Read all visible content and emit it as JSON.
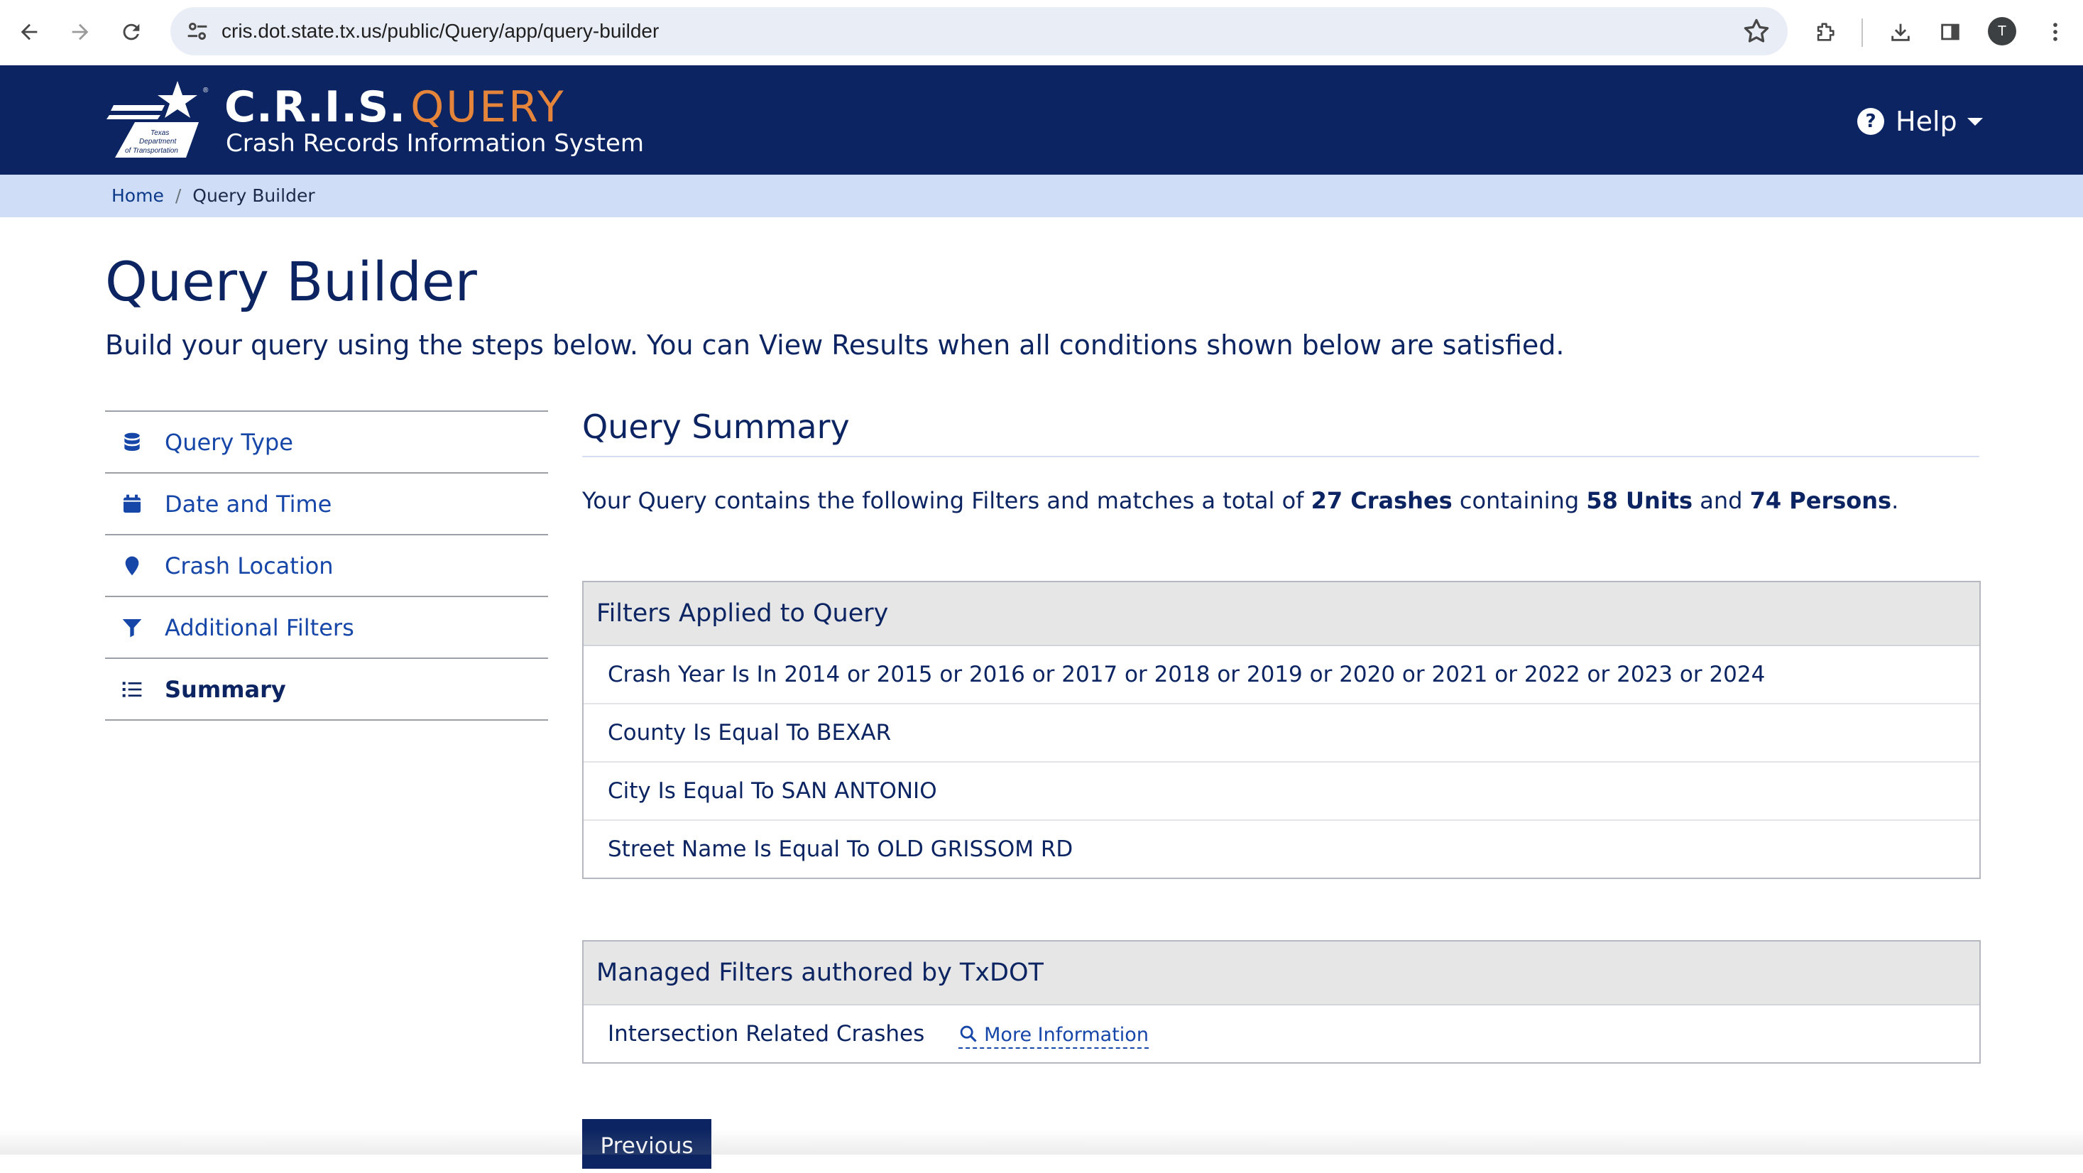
{
  "browser": {
    "url": "cris.dot.state.tx.us/public/Query/app/query-builder",
    "profile_initial": "T"
  },
  "header": {
    "logo_text": "Texas Department of Transportation",
    "brand_main": "C.R.I.S.",
    "brand_query": "QUERY",
    "brand_sub": "Crash Records Information System",
    "help_label": "Help"
  },
  "breadcrumb": {
    "home": "Home",
    "separator": "/",
    "current": "Query Builder"
  },
  "page": {
    "title": "Query Builder",
    "lead": "Build your query using the steps below. You can View Results when all conditions shown below are satisfied."
  },
  "sidenav": {
    "items": [
      {
        "label": "Query Type",
        "icon": "database-icon"
      },
      {
        "label": "Date and Time",
        "icon": "calendar-icon"
      },
      {
        "label": "Crash Location",
        "icon": "map-pin-icon"
      },
      {
        "label": "Additional Filters",
        "icon": "filter-icon"
      },
      {
        "label": "Summary",
        "icon": "list-icon",
        "active": true
      }
    ]
  },
  "summary": {
    "title": "Query Summary",
    "text_prefix": "Your Query contains the following Filters and matches a total of",
    "crashes": "27 Crashes",
    "text_mid1": "containing",
    "units": "58 Units",
    "text_mid2": "and",
    "persons": "74 Persons",
    "text_end": "."
  },
  "filters_panel": {
    "title": "Filters Applied to Query",
    "rows": [
      "Crash Year Is In 2014 or 2015 or 2016 or 2017 or 2018 or 2019 or 2020 or 2021 or 2022 or 2023 or 2024",
      "County Is Equal To BEXAR",
      "City Is Equal To SAN ANTONIO",
      "Street Name Is Equal To OLD GRISSOM RD"
    ]
  },
  "managed_panel": {
    "title": "Managed Filters authored by TxDOT",
    "row_label": "Intersection Related Crashes",
    "more_info": "More Information"
  },
  "buttons": {
    "previous": "Previous"
  },
  "colors": {
    "header_bg": "#0c2562",
    "brand_accent": "#e5843b",
    "breadcrumb_bg": "#cfddf6",
    "link": "#1546a8"
  }
}
